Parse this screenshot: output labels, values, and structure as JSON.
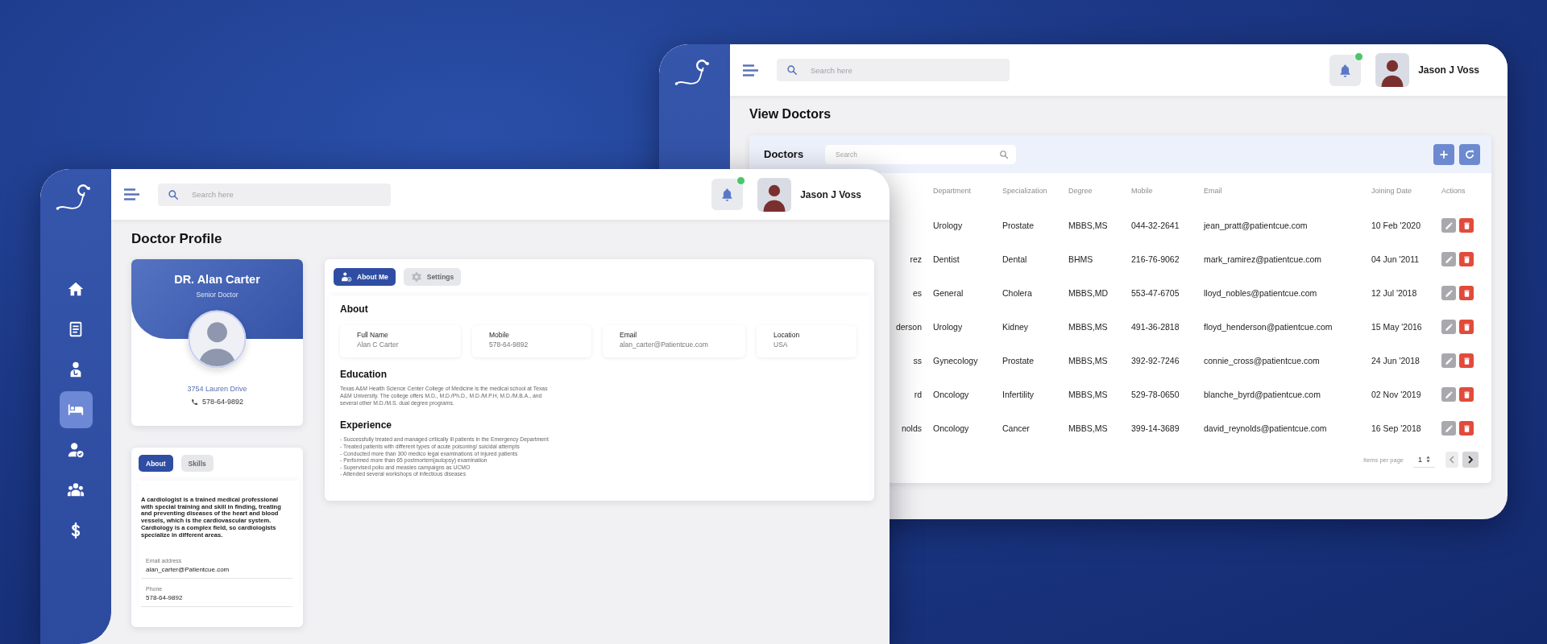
{
  "profile_window": {
    "sidebar": {
      "items": [
        {
          "kind": "home",
          "selected": false
        },
        {
          "kind": "document",
          "selected": false
        },
        {
          "kind": "doctor",
          "selected": false
        },
        {
          "kind": "bed",
          "selected": true
        },
        {
          "kind": "user-check",
          "selected": false
        },
        {
          "kind": "group",
          "selected": false
        },
        {
          "kind": "dollar",
          "selected": false
        }
      ]
    },
    "topbar": {
      "search_placeholder": "Search here",
      "notification_dot": true,
      "user_name": "Jason J Voss"
    },
    "page_title": "Doctor Profile",
    "profile_card": {
      "name": "DR. Alan Carter",
      "role": "Senior Doctor",
      "address": "3754  Lauren Drive",
      "phone": "578-64-9892"
    },
    "about_card": {
      "tabs": [
        {
          "label": "About",
          "selected": true
        },
        {
          "label": "Skills",
          "selected": false
        }
      ],
      "bio": "A cardiologist is a trained medical professional with special training and skill in finding, treating and preventing diseases of the heart and blood vessels, which is the cardiovascular system. Cardiology is a complex field, so cardiologists specialize in different areas.",
      "fields": [
        {
          "label": "Email address",
          "value": "alan_carter@Patientcue.com"
        },
        {
          "label": "Phone",
          "value": "578-64-9892"
        }
      ]
    },
    "details_card": {
      "tabs": [
        {
          "label": "About Me",
          "selected": true,
          "kind": "person-info"
        },
        {
          "label": "Settings",
          "selected": false,
          "kind": "gear"
        }
      ],
      "sections": [
        {
          "kind": "fields",
          "heading": "About",
          "fields": [
            {
              "label": "Full Name",
              "value": "Alan C Carter"
            },
            {
              "label": "Mobile",
              "value": "578-64-9892"
            },
            {
              "label": "Email",
              "value": "alan_carter@Patientcue.com"
            },
            {
              "label": "Location",
              "value": "USA"
            }
          ]
        },
        {
          "kind": "paragraph",
          "heading": "Education",
          "text": "Texas A&M Health Science Center College of Medicine is the medical school at Texas A&M University. The college offers M.D., M.D./Ph.D., M.D./M.P.H, M.D./M.B.A., and several other M.D./M.S. dual degree programs."
        },
        {
          "kind": "bullets",
          "heading": "Experience",
          "items": [
            "- Successfully treated and managed critically ill patients in the Emergency Department",
            "- Treated patients with different types of acute poisoning/ suicidal attempts",
            "- Conducted more than 300 medico legal examinations of injured patients",
            "- Performed more than 65 postmortem(autopsy) examination",
            "- Supervised polio and measles campaigns as UCMO",
            "- Attended several workshops of infectious diseases"
          ]
        }
      ]
    }
  },
  "doctors_window": {
    "topbar": {
      "search_placeholder": "Search here",
      "notification_dot": true,
      "user_name": "Jason J Voss"
    },
    "page_title": "View Doctors",
    "table_card": {
      "title": "Doctors",
      "search_placeholder": "Search",
      "columns": [
        "Department",
        "Specialization",
        "Degree",
        "Mobile",
        "Email",
        "Joining Date",
        "Actions"
      ],
      "rows": [
        {
          "department": "Urology",
          "specialization": "Prostate",
          "degree": "MBBS,MS",
          "mobile": "044-32-2641",
          "email": "jean_pratt@patientcue.com",
          "joining_date": "10 Feb '2020"
        },
        {
          "column_1": "rez",
          "department": "Dentist",
          "specialization": "Dental",
          "degree": "BHMS",
          "mobile": "216-76-9062",
          "email": "mark_ramirez@patientcue.com",
          "joining_date": "04 Jun '2011"
        },
        {
          "column_1": "es",
          "department": "General",
          "specialization": "Cholera",
          "degree": "MBBS,MD",
          "mobile": "553-47-6705",
          "email": "lloyd_nobles@patientcue.com",
          "joining_date": "12 Jul '2018"
        },
        {
          "column_1": "derson",
          "department": "Urology",
          "specialization": "Kidney",
          "degree": "MBBS,MS",
          "mobile": "491-36-2818",
          "email": "floyd_henderson@patientcue.com",
          "joining_date": "15 May '2016"
        },
        {
          "column_1": "ss",
          "department": "Gynecology",
          "specialization": "Prostate",
          "degree": "MBBS,MS",
          "mobile": "392-92-7246",
          "email": "connie_cross@patientcue.com",
          "joining_date": "24 Jun '2018"
        },
        {
          "column_1": "rd",
          "department": "Oncology",
          "specialization": "Infertility",
          "degree": "MBBS,MS",
          "mobile": "529-78-0650",
          "email": "blanche_byrd@patientcue.com",
          "joining_date": "02 Nov '2019"
        },
        {
          "column_1": "nolds",
          "department": "Oncology",
          "specialization": "Cancer",
          "degree": "MBBS,MS",
          "mobile": "399-14-3689",
          "email": "david_reynolds@patientcue.com",
          "joining_date": "16 Sep '2018"
        }
      ],
      "pagination": {
        "label": "Items per page",
        "value": "1"
      }
    }
  }
}
